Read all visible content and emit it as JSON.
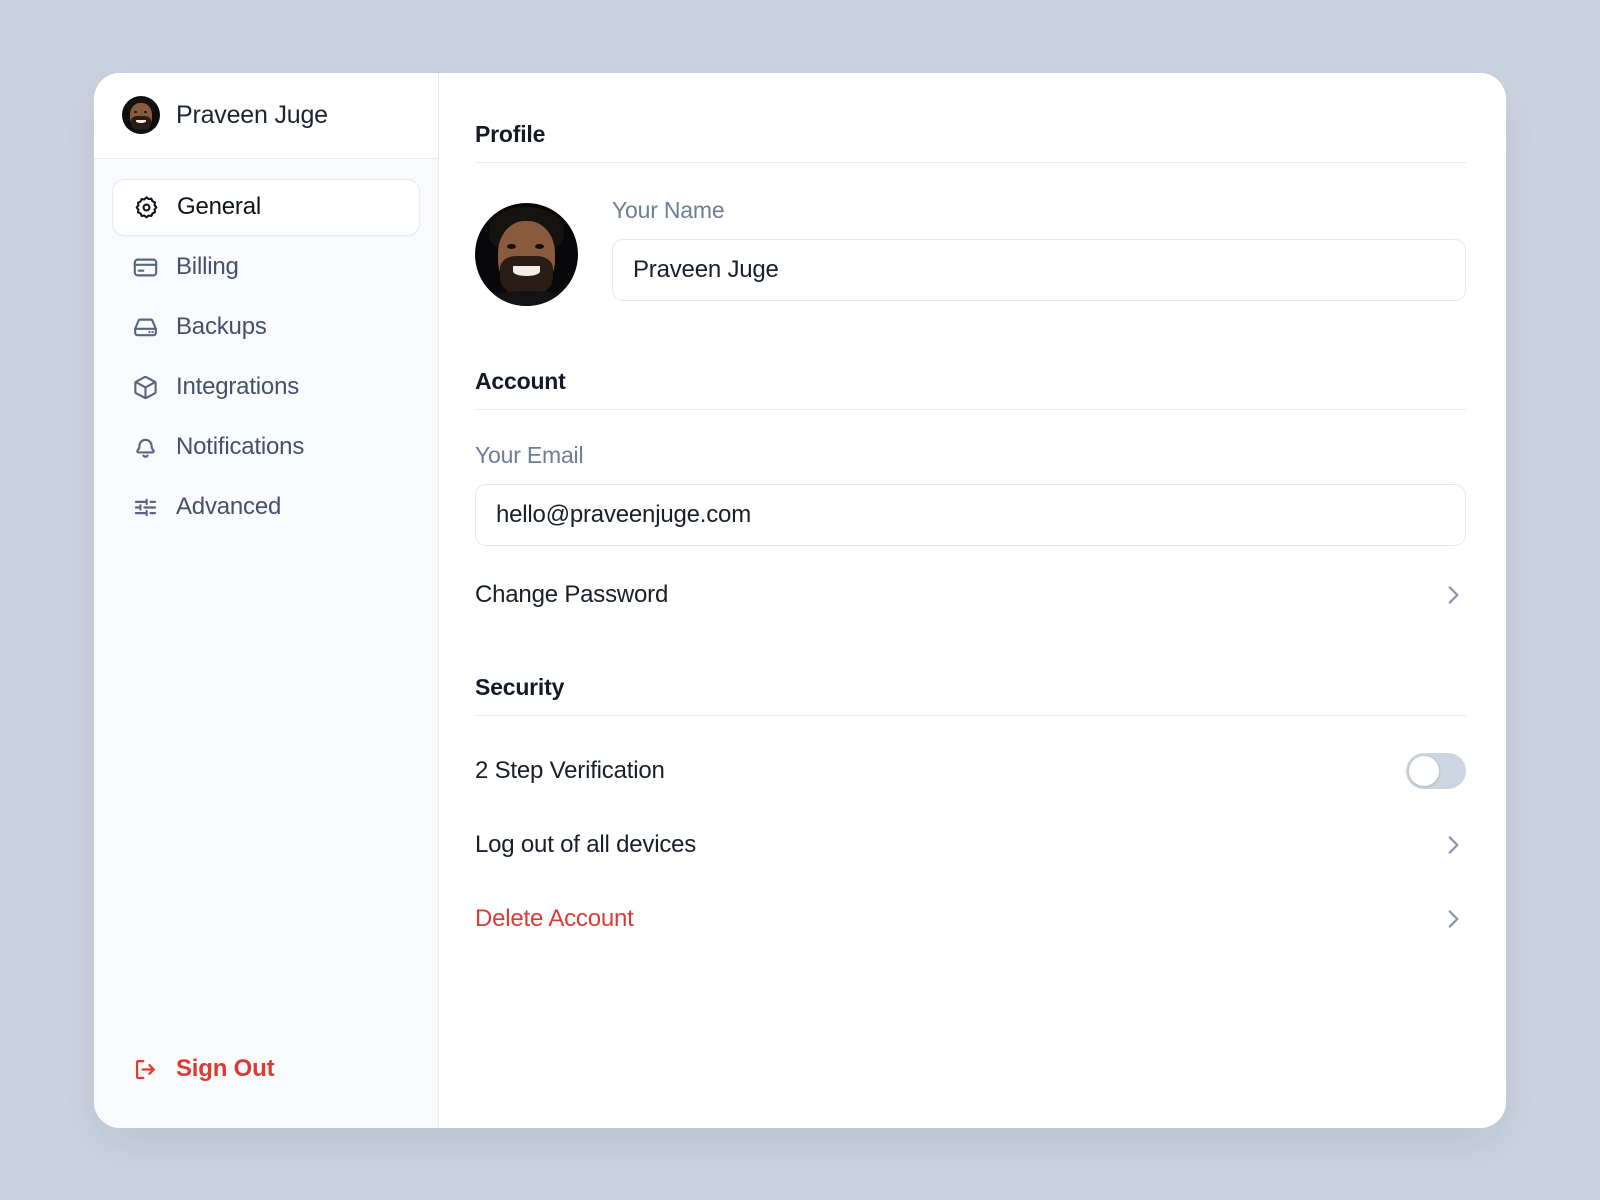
{
  "sidebar": {
    "user": {
      "name": "Praveen Juge",
      "avatar_icon": "user-avatar-photo"
    },
    "items": [
      {
        "label": "General",
        "icon": "settings-rosette-icon"
      },
      {
        "label": "Billing",
        "icon": "credit-card-icon"
      },
      {
        "label": "Backups",
        "icon": "hard-drive-icon"
      },
      {
        "label": "Integrations",
        "icon": "cube-icon"
      },
      {
        "label": "Notifications",
        "icon": "bell-icon"
      },
      {
        "label": "Advanced",
        "icon": "sliders-icon"
      }
    ],
    "active_item": "General",
    "sign_out": {
      "label": "Sign Out",
      "icon": "logout-icon",
      "color": "#dc3b34"
    }
  },
  "content": {
    "profile": {
      "title": "Profile",
      "avatar_icon": "user-avatar-photo",
      "name_field": {
        "label": "Your Name",
        "value": "Praveen Juge",
        "placeholder": "Your Name"
      }
    },
    "account": {
      "title": "Account",
      "email_field": {
        "label": "Your Email",
        "value": "hello@praveenjuge.com",
        "placeholder": "Your Email"
      },
      "change_password": {
        "label": "Change Password",
        "icon": "chevron-right-icon"
      }
    },
    "security": {
      "title": "Security",
      "two_step": {
        "label": "2 Step Verification",
        "toggle_state": "off",
        "toggle_track_color": "#ccd5e1"
      },
      "log_out_all": {
        "label": "Log out of all devices",
        "icon": "chevron-right-icon"
      },
      "delete_account": {
        "label": "Delete Account",
        "icon": "chevron-right-icon",
        "color": "#dc3b34"
      }
    }
  },
  "theme": {
    "page_background": "#ccd4e0",
    "card_background": "#ffffff",
    "sidebar_background": "#f8fafc",
    "text_primary": "#1a1e2c",
    "text_muted": "#6f7c96",
    "danger": "#dc3b34"
  }
}
